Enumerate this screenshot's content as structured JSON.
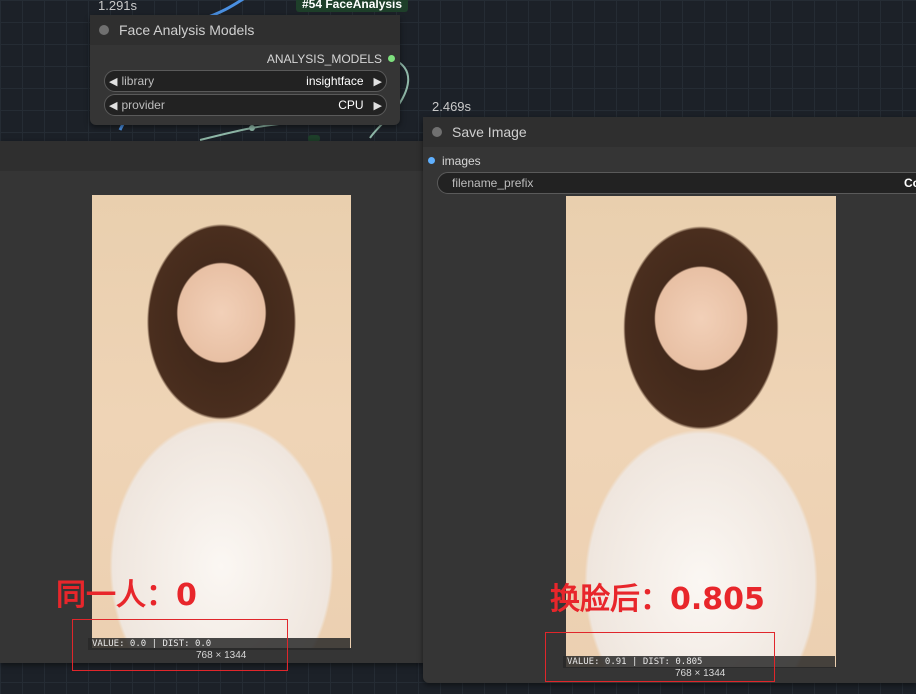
{
  "face_node": {
    "time": "1.291s",
    "badge": "#54 FaceAnalysis",
    "title": "Face Analysis Models",
    "output_label": "ANALYSIS_MODELS",
    "widgets": [
      {
        "label": "library",
        "value": "insightface"
      },
      {
        "label": "provider",
        "value": "CPU"
      }
    ]
  },
  "save_node": {
    "time": "2.469s",
    "title": "Save Image",
    "input_label": "images",
    "prefix_label": "filename_prefix",
    "prefix_value": "Co"
  },
  "left_image": {
    "caption": "VALUE: 0.0 | DIST: 0.0",
    "size": "768 × 1344",
    "annotation": "同一人：0"
  },
  "right_image": {
    "caption": "VALUE: 0.91 | DIST: 0.805",
    "size": "768 × 1344",
    "annotation": "换脸后：0.805"
  },
  "colors": {
    "accent_green": "#7ee07e",
    "accent_blue": "#5fb0ff",
    "annotation_red": "#e8262b"
  }
}
